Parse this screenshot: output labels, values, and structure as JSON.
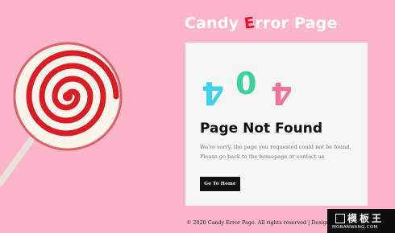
{
  "header": {
    "title_prefix": "Candy ",
    "title_accent": "E",
    "title_suffix": "rror Page"
  },
  "error": {
    "digit_1": "4",
    "digit_2": "0",
    "digit_3": "4",
    "heading": "Page Not Found",
    "message_line_1": "We're sorry, the page you requested could not be found,",
    "message_line_2": "Please go back to the homepage or contact us",
    "button_label": "Go To Home"
  },
  "footer": {
    "text": "© 2020 Candy Error Page. All rights reserved | Design"
  },
  "watermark": {
    "top": "模板王",
    "bottom": "MOBANWANG.COM"
  },
  "colors": {
    "background": "#fdb5c9",
    "accent_red": "#e8112d",
    "digit_cyan": "#3fd0ec",
    "digit_green": "#3ad39a",
    "digit_pink": "#f0739e",
    "button": "#111111"
  }
}
